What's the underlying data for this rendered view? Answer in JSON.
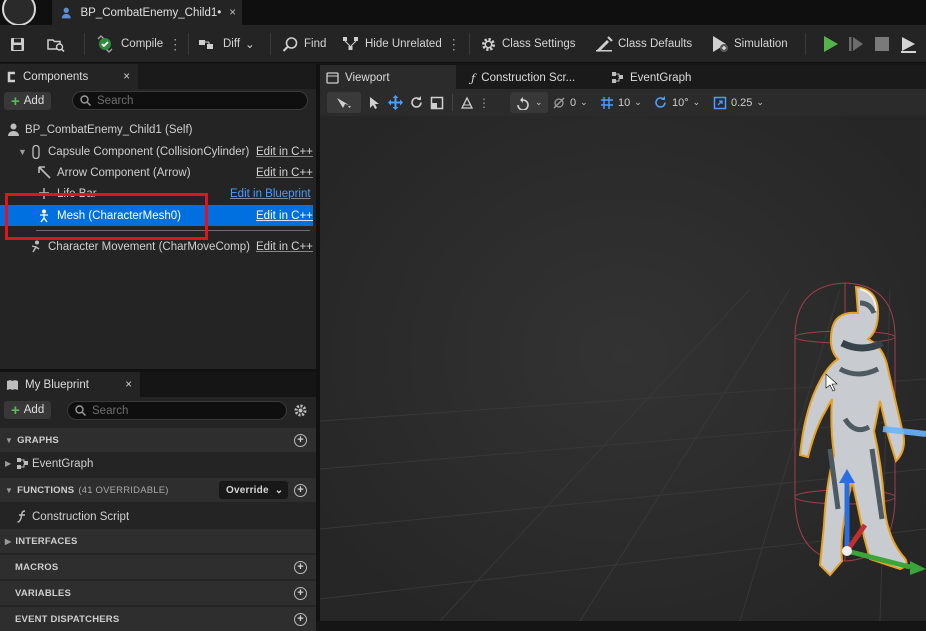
{
  "tab": {
    "title": "BP_CombatEnemy_Child1•",
    "close": "×"
  },
  "toolbar": {
    "compile": "Compile",
    "diff": "Diff",
    "find": "Find",
    "hide_unrelated": "Hide Unrelated",
    "class_settings": "Class Settings",
    "class_defaults": "Class Defaults",
    "simulation": "Simulation"
  },
  "components": {
    "title": "Components",
    "close": "×",
    "add": "Add",
    "search_placeholder": "Search",
    "items": [
      {
        "label": "BP_CombatEnemy_Child1 (Self)",
        "edit": ""
      },
      {
        "label": "Capsule Component (CollisionCylinder)",
        "edit": "Edit in C++"
      },
      {
        "label": "Arrow Component (Arrow)",
        "edit": "Edit in C++"
      },
      {
        "label": "Life Bar",
        "edit": "Edit in Blueprint"
      },
      {
        "label": "Mesh (CharacterMesh0)",
        "edit": "Edit in C++"
      },
      {
        "label": "Character Movement (CharMoveComp)",
        "edit": "Edit in C++"
      }
    ]
  },
  "my_blueprint": {
    "title": "My Blueprint",
    "close": "×",
    "add": "Add",
    "search_placeholder": "Search",
    "graphs": "GRAPHS",
    "event_graph": "EventGraph",
    "functions": "FUNCTIONS",
    "functions_count": "(41 OVERRIDABLE)",
    "override": "Override",
    "construction_script": "Construction Script",
    "interfaces": "INTERFACES",
    "macros": "MACROS",
    "variables": "VARIABLES",
    "event_dispatchers": "EVENT DISPATCHERS"
  },
  "viewport_tabs": {
    "viewport": "Viewport",
    "construction": "Construction Scr...",
    "event_graph": "EventGraph"
  },
  "viewport_toolbar": {
    "rotation_snap": "0",
    "grid_snap": "10",
    "angle_snap": "10°",
    "scale_snap": "0.25"
  },
  "colors": {
    "selection": "#0070e0",
    "highlight_box": "#e0141e",
    "play": "#4caf50",
    "edit_link": "#4a9eff"
  }
}
